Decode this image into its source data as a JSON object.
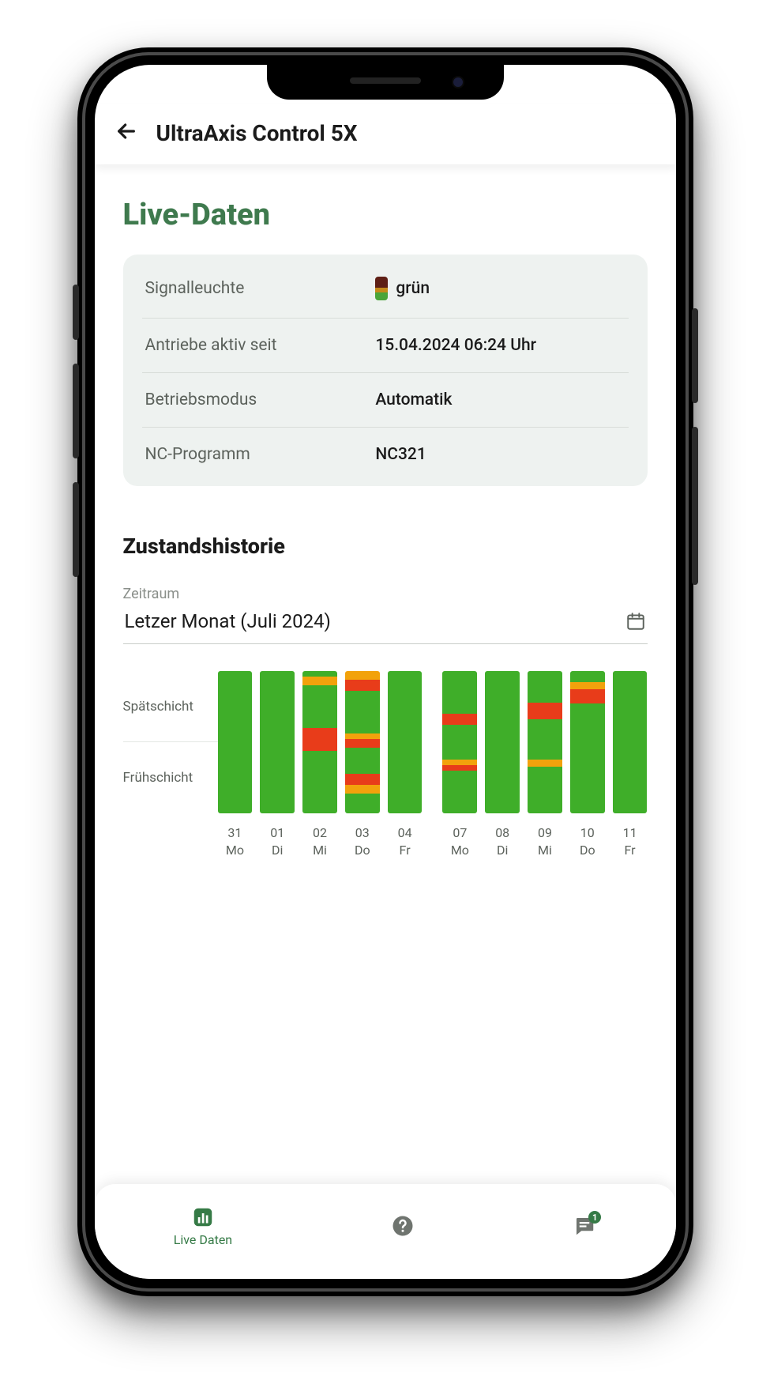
{
  "header": {
    "title": "UltraAxis Control 5X"
  },
  "sections": {
    "live_title": "Live-Daten",
    "history_title": "Zustandshistorie",
    "period_label": "Zeitraum",
    "period_value": "Letzer Monat (Juli 2024)"
  },
  "live_rows": {
    "signal_k": "Signalleuchte",
    "signal_v": "grün",
    "drives_k": "Antriebe aktiv seit",
    "drives_v": "15.04.2024 06:24 Uhr",
    "mode_k": "Betriebsmodus",
    "mode_v": "Automatik",
    "nc_k": "NC-Programm",
    "nc_v": "NC321"
  },
  "chart_data": {
    "type": "bar",
    "ylabels": [
      "Spätschicht",
      "Frühschicht"
    ],
    "colors": {
      "ok": "#3FAE29",
      "warn": "#F2A20C",
      "err": "#E83C1A"
    },
    "days": [
      {
        "d": "31",
        "w": "Mo",
        "segs": [
          [
            "ok",
            100
          ]
        ]
      },
      {
        "d": "01",
        "w": "Di",
        "segs": [
          [
            "ok",
            100
          ]
        ]
      },
      {
        "d": "02",
        "w": "Mi",
        "segs": [
          [
            "ok",
            4
          ],
          [
            "warn",
            6
          ],
          [
            "ok",
            30
          ],
          [
            "err",
            16
          ],
          [
            "ok",
            44
          ]
        ]
      },
      {
        "d": "03",
        "w": "Do",
        "segs": [
          [
            "warn",
            6
          ],
          [
            "err",
            8
          ],
          [
            "ok",
            30
          ],
          [
            "warn",
            4
          ],
          [
            "err",
            6
          ],
          [
            "ok",
            18
          ],
          [
            "err",
            8
          ],
          [
            "warn",
            6
          ],
          [
            "ok",
            14
          ]
        ]
      },
      {
        "d": "04",
        "w": "Fr",
        "segs": [
          [
            "ok",
            100
          ]
        ]
      },
      {
        "gap": true
      },
      {
        "d": "07",
        "w": "Mo",
        "segs": [
          [
            "ok",
            30
          ],
          [
            "err",
            8
          ],
          [
            "ok",
            24
          ],
          [
            "warn",
            4
          ],
          [
            "err",
            4
          ],
          [
            "ok",
            30
          ]
        ]
      },
      {
        "d": "08",
        "w": "Di",
        "segs": [
          [
            "ok",
            100
          ]
        ]
      },
      {
        "d": "09",
        "w": "Mi",
        "segs": [
          [
            "ok",
            22
          ],
          [
            "err",
            12
          ],
          [
            "ok",
            28
          ],
          [
            "warn",
            5
          ],
          [
            "ok",
            33
          ]
        ]
      },
      {
        "d": "10",
        "w": "Do",
        "segs": [
          [
            "ok",
            8
          ],
          [
            "warn",
            5
          ],
          [
            "err",
            10
          ],
          [
            "ok",
            77
          ]
        ]
      },
      {
        "d": "11",
        "w": "Fr",
        "segs": [
          [
            "ok",
            100
          ]
        ]
      }
    ]
  },
  "bottom_nav": {
    "live": "Live Daten",
    "help": "",
    "chat_badge": "1"
  }
}
